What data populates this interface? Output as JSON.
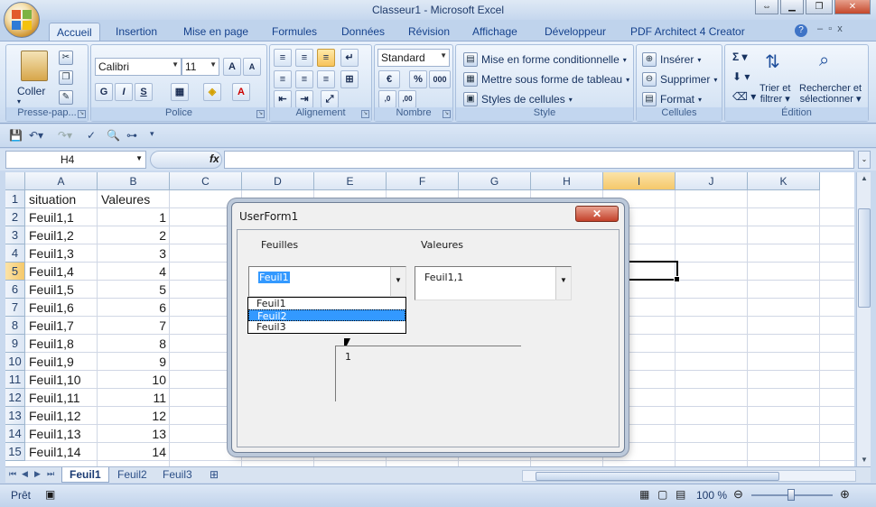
{
  "window": {
    "title": "Classeur1 - Microsoft Excel"
  },
  "ribbon_tabs": [
    "Accueil",
    "Insertion",
    "Mise en page",
    "Formules",
    "Données",
    "Révision",
    "Affichage",
    "Développeur",
    "PDF Architect 4 Creator"
  ],
  "ribbon": {
    "clipboard": {
      "paste": "Coller",
      "label": "Presse-pap..."
    },
    "font": {
      "name": "Calibri",
      "size": "11",
      "label": "Police"
    },
    "alignment": {
      "label": "Alignement"
    },
    "number": {
      "format": "Standard",
      "percent": "%",
      "thousands": "000",
      "label": "Nombre"
    },
    "styles": {
      "conditional": "Mise en forme conditionnelle",
      "table": "Mettre sous forme de tableau",
      "cell": "Styles de cellules",
      "label": "Style"
    },
    "cells": {
      "insert": "Insérer",
      "delete": "Supprimer",
      "format": "Format",
      "label": "Cellules"
    },
    "editing": {
      "sort": "Trier et",
      "filter": "filtrer",
      "find": "Rechercher et",
      "select": "sélectionner",
      "label": "Édition"
    }
  },
  "formula_bar": {
    "name_box": "H4",
    "fx": "fx",
    "value": ""
  },
  "columns": [
    "A",
    "B",
    "C",
    "D",
    "E",
    "F",
    "G",
    "H",
    "I",
    "J",
    "K"
  ],
  "rows": [
    {
      "n": "1",
      "a": "situation",
      "b": "Valeures"
    },
    {
      "n": "2",
      "a": "Feuil1,1",
      "b": "1"
    },
    {
      "n": "3",
      "a": "Feuil1,2",
      "b": "2"
    },
    {
      "n": "4",
      "a": "Feuil1,3",
      "b": "3"
    },
    {
      "n": "5",
      "a": "Feuil1,4",
      "b": "4"
    },
    {
      "n": "6",
      "a": "Feuil1,5",
      "b": "5"
    },
    {
      "n": "7",
      "a": "Feuil1,6",
      "b": "6"
    },
    {
      "n": "8",
      "a": "Feuil1,7",
      "b": "7"
    },
    {
      "n": "9",
      "a": "Feuil1,8",
      "b": "8"
    },
    {
      "n": "10",
      "a": "Feuil1,9",
      "b": "9"
    },
    {
      "n": "11",
      "a": "Feuil1,10",
      "b": "10"
    },
    {
      "n": "12",
      "a": "Feuil1,11",
      "b": "11"
    },
    {
      "n": "13",
      "a": "Feuil1,12",
      "b": "12"
    },
    {
      "n": "14",
      "a": "Feuil1,13",
      "b": "13"
    },
    {
      "n": "15",
      "a": "Feuil1,14",
      "b": "14"
    }
  ],
  "sheets": [
    "Feuil1",
    "Feuil2",
    "Feuil3"
  ],
  "status": {
    "ready": "Prêt",
    "zoom": "100 %"
  },
  "userform": {
    "title": "UserForm1",
    "close": "✕",
    "label_sheets": "Feuilles",
    "label_values": "Valeures",
    "sheets_value": "Feuil1",
    "values_value": "Feuil1,1",
    "dropdown_items": [
      "Feuil1",
      "Feuil2",
      "Feuil3"
    ],
    "textbox_value": "1"
  }
}
